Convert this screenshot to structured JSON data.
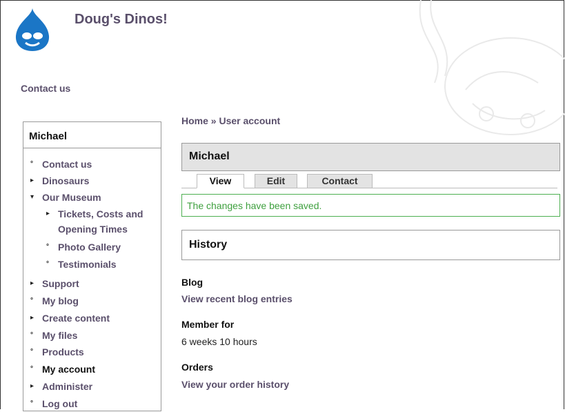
{
  "site": {
    "name": "Doug's Dinos!"
  },
  "primary_links": {
    "contact": "Contact us"
  },
  "sidebar": {
    "title": "Michael",
    "items": [
      {
        "label": "Contact us",
        "bullet": "°"
      },
      {
        "label": "Dinosaurs",
        "bullet": "▸"
      },
      {
        "label": "Our Museum",
        "bullet": "▾"
      },
      {
        "label": "Tickets, Costs and",
        "label2": "Opening Times",
        "bullet": "▸"
      },
      {
        "label": "Photo Gallery",
        "bullet": "°"
      },
      {
        "label": "Testimonials",
        "bullet": "°"
      },
      {
        "label": "Support",
        "bullet": "▸"
      },
      {
        "label": "My blog",
        "bullet": "°"
      },
      {
        "label": "Create content",
        "bullet": "▸"
      },
      {
        "label": "My files",
        "bullet": "°"
      },
      {
        "label": "Products",
        "bullet": "°"
      },
      {
        "label": "My account",
        "bullet": "°"
      },
      {
        "label": "Administer",
        "bullet": "▸"
      },
      {
        "label": "Log out",
        "bullet": "°"
      }
    ]
  },
  "breadcrumb": "Home » User account",
  "page_title": "Michael",
  "tabs": [
    {
      "label": "View"
    },
    {
      "label": "Edit"
    },
    {
      "label": "Contact"
    }
  ],
  "status_message": "The changes have been saved.",
  "history_title": "History",
  "sections": {
    "blog": {
      "heading": "Blog",
      "value": "View recent blog entries"
    },
    "member_for": {
      "heading": "Member for",
      "value": "6 weeks 10 hours"
    },
    "orders": {
      "heading": "Orders",
      "value": "View your order history"
    }
  },
  "colors": {
    "link": "#5a4f6b",
    "status_green": "#3fa03f",
    "title_bg": "#e3e3e3",
    "logo_blue": "#1b76c6"
  }
}
